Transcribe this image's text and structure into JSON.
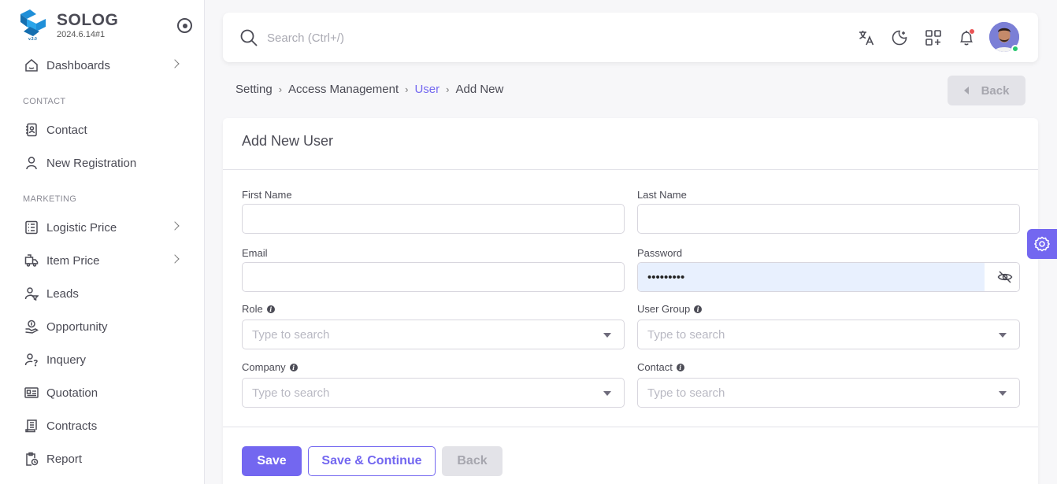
{
  "brand": {
    "name": "SOLOG",
    "version": "2024.6.14#1"
  },
  "sidebar": {
    "items": [
      {
        "label": "Dashboards"
      },
      {
        "label": "Contact"
      },
      {
        "label": "New Registration"
      },
      {
        "label": "Logistic Price"
      },
      {
        "label": "Item Price"
      },
      {
        "label": "Leads"
      },
      {
        "label": "Opportunity"
      },
      {
        "label": "Inquery"
      },
      {
        "label": "Quotation"
      },
      {
        "label": "Contracts"
      },
      {
        "label": "Report"
      }
    ],
    "sections": {
      "contact": "CONTACT",
      "marketing": "MARKETING"
    }
  },
  "search": {
    "placeholder": "Search (Ctrl+/)"
  },
  "breadcrumb": {
    "setting": "Setting",
    "access": "Access Management",
    "user": "User",
    "current": "Add New"
  },
  "header_back": "Back",
  "form": {
    "title": "Add New User",
    "first_name": {
      "label": "First Name",
      "value": ""
    },
    "last_name": {
      "label": "Last Name",
      "value": ""
    },
    "email": {
      "label": "Email",
      "value": ""
    },
    "password": {
      "label": "Password",
      "value": "•••••••••"
    },
    "role": {
      "label": "Role",
      "placeholder": "Type to search"
    },
    "user_group": {
      "label": "User Group",
      "placeholder": "Type to search"
    },
    "company": {
      "label": "Company",
      "placeholder": "Type to search"
    },
    "contact": {
      "label": "Contact",
      "placeholder": "Type to search"
    }
  },
  "actions": {
    "save": "Save",
    "save_continue": "Save & Continue",
    "back": "Back"
  },
  "colors": {
    "primary": "#7367f0",
    "text": "#4b4b55",
    "notification": "#ea5455",
    "online": "#28c76f"
  }
}
